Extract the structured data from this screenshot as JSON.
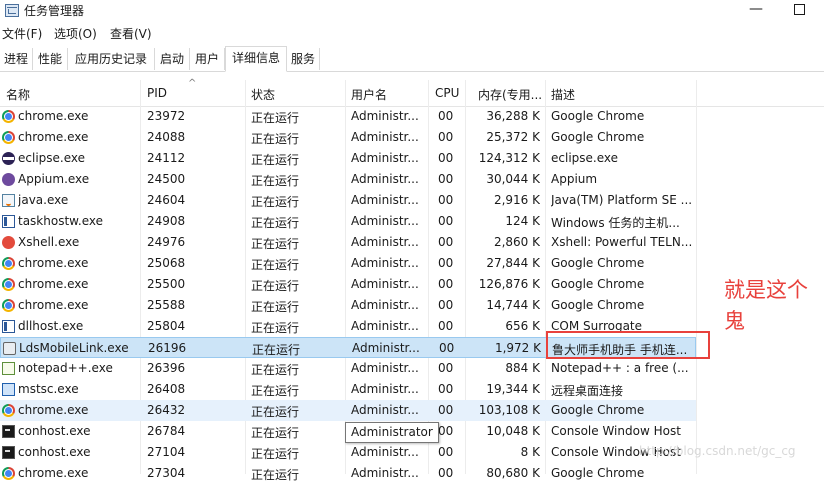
{
  "window": {
    "title": "任务管理器",
    "minimize": "—"
  },
  "menu": [
    "文件(F)",
    "选项(O)",
    "查看(V)"
  ],
  "tabs": [
    "进程",
    "性能",
    "应用历史记录",
    "启动",
    "用户",
    "详细信息",
    "服务"
  ],
  "active_tab": "详细信息",
  "columns": {
    "name": "名称",
    "pid": "PID",
    "state": "状态",
    "user": "用户名",
    "cpu": "CPU",
    "mem": "内存(专用...",
    "desc": "描述"
  },
  "sort_indicator": "^",
  "rows": [
    {
      "icon": "chrome-icon",
      "name": "chrome.exe",
      "pid": "23972",
      "state": "正在运行",
      "user": "Administr...",
      "cpu": "00",
      "mem": "36,288 K",
      "desc": "Google Chrome"
    },
    {
      "icon": "chrome-icon",
      "name": "chrome.exe",
      "pid": "24088",
      "state": "正在运行",
      "user": "Administr...",
      "cpu": "00",
      "mem": "25,372 K",
      "desc": "Google Chrome"
    },
    {
      "icon": "eclipse-icon",
      "name": "eclipse.exe",
      "pid": "24112",
      "state": "正在运行",
      "user": "Administr...",
      "cpu": "00",
      "mem": "124,312 K",
      "desc": "eclipse.exe"
    },
    {
      "icon": "appium-icon",
      "name": "Appium.exe",
      "pid": "24500",
      "state": "正在运行",
      "user": "Administr...",
      "cpu": "00",
      "mem": "30,044 K",
      "desc": "Appium"
    },
    {
      "icon": "java-icon",
      "name": "java.exe",
      "pid": "24604",
      "state": "正在运行",
      "user": "Administr...",
      "cpu": "00",
      "mem": "2,916 K",
      "desc": "Java(TM) Platform SE ..."
    },
    {
      "icon": "window-icon",
      "name": "taskhostw.exe",
      "pid": "24908",
      "state": "正在运行",
      "user": "Administr...",
      "cpu": "00",
      "mem": "124 K",
      "desc": "Windows 任务的主机..."
    },
    {
      "icon": "xshell-icon",
      "name": "Xshell.exe",
      "pid": "24976",
      "state": "正在运行",
      "user": "Administr...",
      "cpu": "00",
      "mem": "2,860 K",
      "desc": "Xshell: Powerful TELN..."
    },
    {
      "icon": "chrome-icon",
      "name": "chrome.exe",
      "pid": "25068",
      "state": "正在运行",
      "user": "Administr...",
      "cpu": "00",
      "mem": "27,844 K",
      "desc": "Google Chrome"
    },
    {
      "icon": "chrome-icon",
      "name": "chrome.exe",
      "pid": "25500",
      "state": "正在运行",
      "user": "Administr...",
      "cpu": "00",
      "mem": "126,876 K",
      "desc": "Google Chrome"
    },
    {
      "icon": "chrome-icon",
      "name": "chrome.exe",
      "pid": "25588",
      "state": "正在运行",
      "user": "Administr...",
      "cpu": "00",
      "mem": "14,744 K",
      "desc": "Google Chrome"
    },
    {
      "icon": "window-icon",
      "name": "dllhost.exe",
      "pid": "25804",
      "state": "正在运行",
      "user": "Administr...",
      "cpu": "00",
      "mem": "656 K",
      "desc": "COM Surrogate"
    },
    {
      "icon": "lds-icon",
      "name": "LdsMobileLink.exe",
      "pid": "26196",
      "state": "正在运行",
      "user": "Administr...",
      "cpu": "00",
      "mem": "1,972 K",
      "desc": "鲁大师手机助手 手机连..."
    },
    {
      "icon": "notepad-icon",
      "name": "notepad++.exe",
      "pid": "26396",
      "state": "正在运行",
      "user": "Administr...",
      "cpu": "00",
      "mem": "884 K",
      "desc": "Notepad++ : a free (..."
    },
    {
      "icon": "mstsc-icon",
      "name": "mstsc.exe",
      "pid": "26408",
      "state": "正在运行",
      "user": "Administr...",
      "cpu": "00",
      "mem": "19,344 K",
      "desc": "远程桌面连接"
    },
    {
      "icon": "chrome-icon",
      "name": "chrome.exe",
      "pid": "26432",
      "state": "正在运行",
      "user": "Administr...",
      "cpu": "00",
      "mem": "103,108 K",
      "desc": "Google Chrome"
    },
    {
      "icon": "console-icon",
      "name": "conhost.exe",
      "pid": "26784",
      "state": "正在运行",
      "user": "Administr...",
      "cpu": "00",
      "mem": "10,048 K",
      "desc": "Console Window Host"
    },
    {
      "icon": "console-icon",
      "name": "conhost.exe",
      "pid": "27104",
      "state": "正在运行",
      "user": "Administr...",
      "cpu": "00",
      "mem": "8 K",
      "desc": "Console Window Host"
    },
    {
      "icon": "chrome-icon",
      "name": "chrome.exe",
      "pid": "27304",
      "state": "正在运行",
      "user": "Administr...",
      "cpu": "00",
      "mem": "80,680 K",
      "desc": "Google Chrome"
    }
  ],
  "selected_row": 11,
  "hover_row": 14,
  "tooltip": "Administrator",
  "annotation": "就是这个鬼",
  "watermark": "http://blog.csdn.net/gc_cg",
  "colors": {
    "annotation": "#e8413c",
    "selected_bg": "#cce4f7",
    "hover_bg": "#e6f1fc"
  }
}
